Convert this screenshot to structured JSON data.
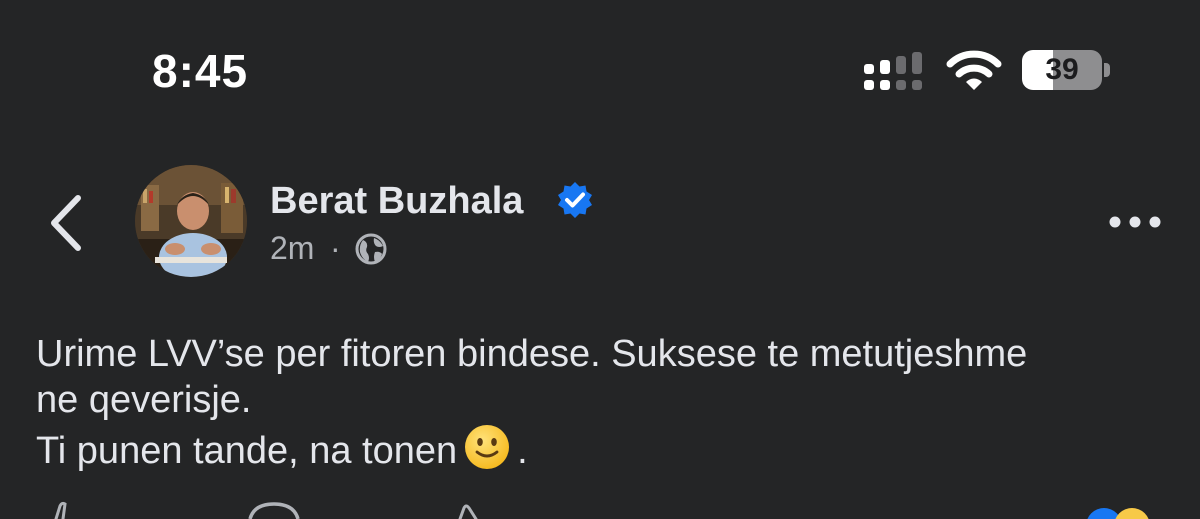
{
  "status_bar": {
    "time": "8:45",
    "battery_level": "39",
    "icons": [
      "cellular-signal-icon",
      "wifi-icon",
      "battery-icon"
    ]
  },
  "header": {
    "back_icon": "chevron-left-icon",
    "author_name": "Berat Buzhala",
    "verified_icon": "verified-badge-icon",
    "time_ago": "2m",
    "separator": "·",
    "audience_icon": "globe-icon",
    "more_icon": "more-options-icon"
  },
  "post": {
    "lines": [
      "Urime LVV’se per fitoren bindese. Suksese te metutjeshme",
      "ne qeverisje.",
      "Ti punen tande, na tonen"
    ],
    "trailing_emoji": "slightly-smiling-face",
    "trailing_punct": "."
  },
  "colors": {
    "background": "#242526",
    "text": "#e4e6eb",
    "secondary": "#b0b3b8",
    "verified_blue": "#1877f2"
  }
}
